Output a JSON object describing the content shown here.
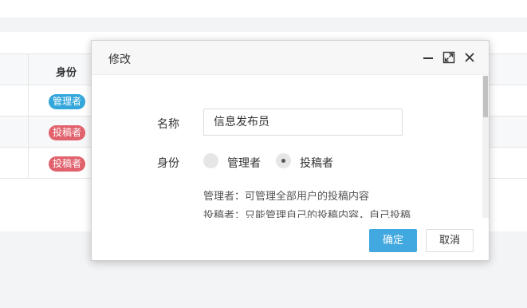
{
  "table": {
    "header": {
      "role": "身份"
    },
    "rows": [
      {
        "role": "管理者",
        "role_color": "#33a7db"
      },
      {
        "role": "投稿者",
        "role_color": "#e1626c"
      },
      {
        "role": "投稿者",
        "role_color": "#e1626c"
      }
    ]
  },
  "modal": {
    "title": "修改",
    "header_icons": [
      "minimize-icon",
      "maximize-icon",
      "close-icon"
    ],
    "form": {
      "name_label": "名称",
      "name_value": "信息发布员",
      "role_label": "身份",
      "role_options": [
        {
          "label": "管理者",
          "checked": false
        },
        {
          "label": "投稿者",
          "checked": true
        }
      ],
      "help_lines": [
        "管理者：可管理全部用户的投稿内容",
        "投稿者：只能管理自己的投稿内容，自己投稿"
      ]
    },
    "buttons": {
      "ok": "确定",
      "cancel": "取消"
    },
    "accent_color": "#42a8e0"
  }
}
